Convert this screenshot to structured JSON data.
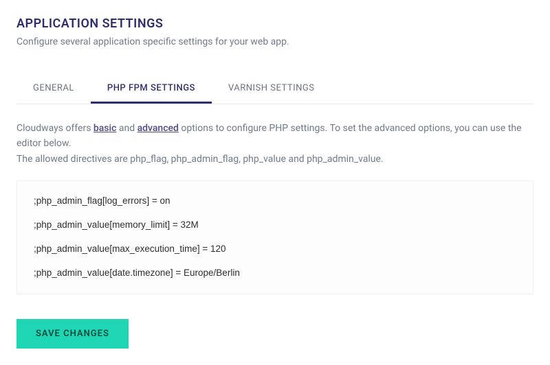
{
  "header": {
    "title": "APPLICATION SETTINGS",
    "subtitle": "Configure several application specific settings for your web app."
  },
  "tabs": {
    "general": "GENERAL",
    "phpfpm": "PHP FPM SETTINGS",
    "varnish": "VARNISH SETTINGS"
  },
  "desc": {
    "part1": "Cloudways offers ",
    "link_basic": "basic",
    "part2": " and ",
    "link_advanced": "advanced",
    "part3": "  options to configure PHP settings. To set the advanced options, you can use the editor below.",
    "line2": "The allowed directives are php_flag, php_admin_flag, php_value and php_admin_value."
  },
  "editor": {
    "lines": [
      ";php_admin_flag[log_errors] = on",
      ";php_admin_value[memory_limit] = 32M",
      ";php_admin_value[max_execution_time] = 120",
      ";php_admin_value[date.timezone] = Europe/Berlin"
    ]
  },
  "actions": {
    "save": "SAVE CHANGES"
  }
}
